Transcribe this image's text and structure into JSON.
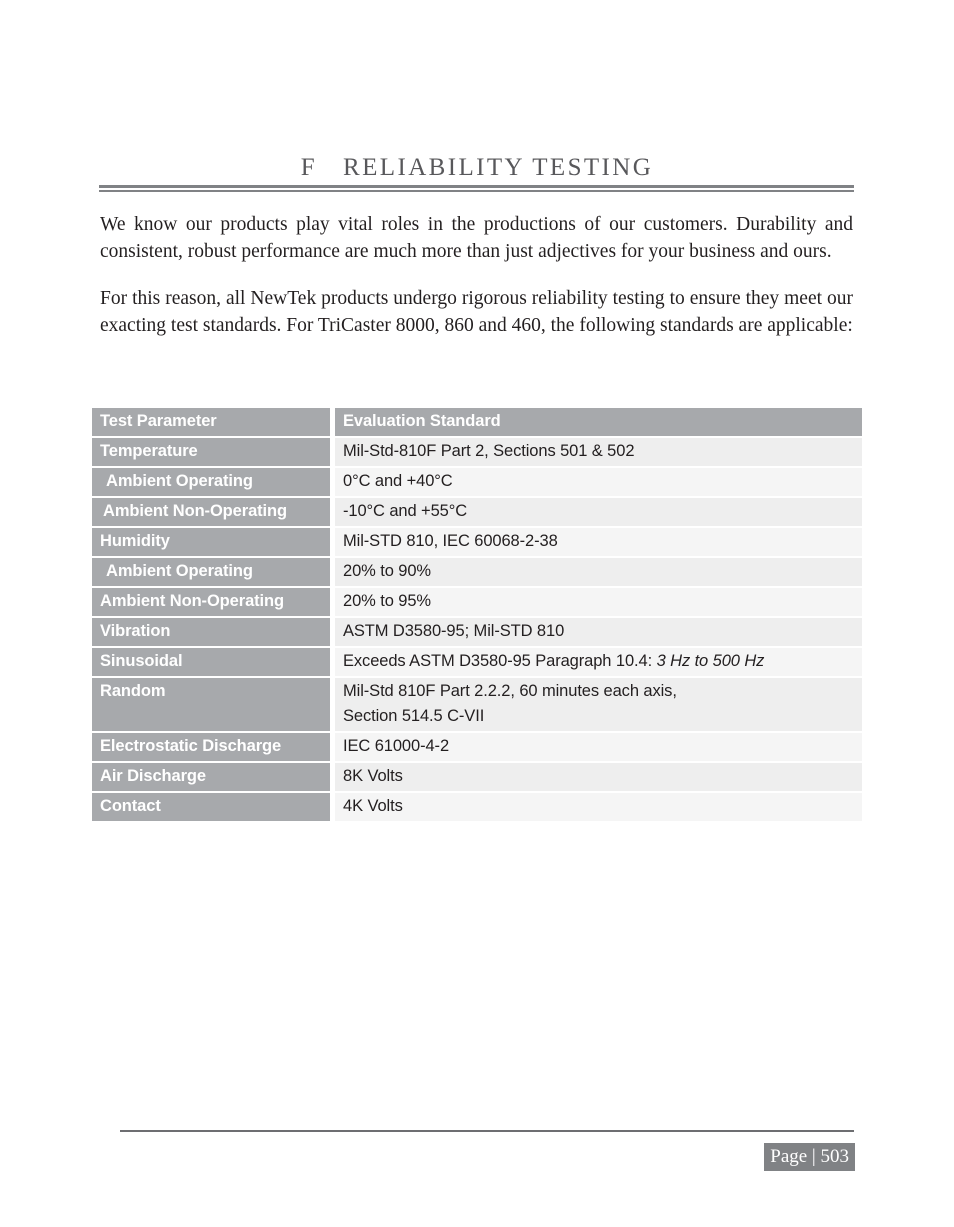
{
  "document": {
    "chapter_heading": "F   RELIABILITY TESTING",
    "paragraphs": [
      "We know our products play vital roles in the productions of our customers. Durability and consistent, robust performance are much more than just adjectives for your business and ours.",
      "For this reason, all NewTek products undergo rigorous reliability testing to ensure they meet our exacting test standards.   For TriCaster 8000, 860 and 460, the following standards are applicable:"
    ]
  },
  "table": {
    "headers": {
      "parameter": "Test Parameter",
      "standard": "Evaluation Standard"
    },
    "rows": [
      {
        "parameter": "Temperature",
        "value": "Mil-Std-810F Part 2, Sections 501 & 502"
      },
      {
        "parameter": "Ambient Operating",
        "value": "0°C and +40°C"
      },
      {
        "parameter": "Ambient Non-Operating",
        "value": "-10°C  and +55°C"
      },
      {
        "parameter": "Humidity",
        "value": "Mil-STD 810, IEC 60068-2-38"
      },
      {
        "parameter": "Ambient Operating",
        "value": "20% to 90%"
      },
      {
        "parameter": "Ambient Non-Operating",
        "value": "20% to 95%"
      },
      {
        "parameter": "Vibration",
        "value": "ASTM D3580-95; Mil-STD 810"
      },
      {
        "parameter": "Sinusoidal",
        "value": "Exceeds  ASTM D3580-95 Paragraph 10.4: ",
        "value_italic": "3 Hz to 500 Hz"
      },
      {
        "parameter": "Random",
        "value": "Mil-Std 810F Part 2.2.2, 60 minutes each axis,",
        "value_line2": "Section 514.5 C-VII"
      },
      {
        "parameter": "Electrostatic Discharge",
        "value": "IEC 61000-4-2"
      },
      {
        "parameter": "Air Discharge",
        "value": "8K Volts"
      },
      {
        "parameter": "Contact",
        "value": "4K Volts"
      }
    ]
  },
  "footer": {
    "page_label": "Page | 503"
  },
  "colors": {
    "heading_text": "#58585b",
    "rule": "#808285",
    "table_header_bg": "#a7a9ac",
    "table_param_bg": "#a7a9ac",
    "table_value_bg_odd": "#eeeeee",
    "table_value_bg_even": "#f5f5f5",
    "page_number_bg": "#808285",
    "body_text": "#231f20"
  }
}
